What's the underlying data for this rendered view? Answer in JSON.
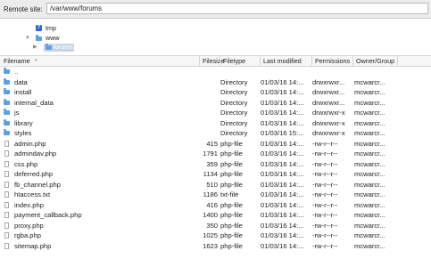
{
  "remote_site": {
    "label": "Remote site:",
    "path": "/var/www/forums"
  },
  "tree": [
    {
      "label": "tmp",
      "icon": "question-icon"
    },
    {
      "label": "www",
      "icon": "folder-icon"
    },
    {
      "label": "forums",
      "icon": "folder-icon",
      "selected": true
    }
  ],
  "columns": {
    "filename": "Filename",
    "filesize": "Filesize",
    "filetype": "Filetype",
    "modified": "Last modified",
    "permissions": "Permissions",
    "owner": "Owner/Group"
  },
  "rows": [
    {
      "name": "..",
      "kind": "folder",
      "size": "",
      "type": "",
      "modified": "",
      "perms": "",
      "owner": ""
    },
    {
      "name": "data",
      "kind": "folder",
      "size": "",
      "type": "Directory",
      "modified": "01/03/16 14:...",
      "perms": "drwxrwxr...",
      "owner": "mcwarcr..."
    },
    {
      "name": "install",
      "kind": "folder",
      "size": "",
      "type": "Directory",
      "modified": "01/03/16 14:...",
      "perms": "drwxrwxr...",
      "owner": "mcwarcr..."
    },
    {
      "name": "internal_data",
      "kind": "folder",
      "size": "",
      "type": "Directory",
      "modified": "01/03/16 14:...",
      "perms": "drwxrwxr...",
      "owner": "mcwarcr..."
    },
    {
      "name": "js",
      "kind": "folder",
      "size": "",
      "type": "Directory",
      "modified": "01/03/16 14:...",
      "perms": "drwxrwxr-x",
      "owner": "mcwarcr..."
    },
    {
      "name": "library",
      "kind": "folder",
      "size": "",
      "type": "Directory",
      "modified": "01/03/16 14:...",
      "perms": "drwxrwxr-x",
      "owner": "mcwarcr..."
    },
    {
      "name": "styles",
      "kind": "folder",
      "size": "",
      "type": "Directory",
      "modified": "01/03/16 15:...",
      "perms": "drwxrwxr-x",
      "owner": "mcwarcr..."
    },
    {
      "name": "admin.php",
      "kind": "file",
      "size": "415",
      "type": "php-file",
      "modified": "01/03/16 14:...",
      "perms": "-rw-r--r--",
      "owner": "mcwarcr..."
    },
    {
      "name": "admindav.php",
      "kind": "file",
      "size": "1791",
      "type": "php-file",
      "modified": "01/03/16 14:...",
      "perms": "-rw-r--r--",
      "owner": "mcwarcr..."
    },
    {
      "name": "css.php",
      "kind": "file",
      "size": "359",
      "type": "php-file",
      "modified": "01/03/16 14:...",
      "perms": "-rw-r--r--",
      "owner": "mcwarcr..."
    },
    {
      "name": "deferred.php",
      "kind": "file",
      "size": "1134",
      "type": "php-file",
      "modified": "01/03/16 14:...",
      "perms": "-rw-r--r--",
      "owner": "mcwarcr..."
    },
    {
      "name": "fb_channel.php",
      "kind": "file",
      "size": "510",
      "type": "php-file",
      "modified": "01/03/16 14:...",
      "perms": "-rw-r--r--",
      "owner": "mcwarcr..."
    },
    {
      "name": "htaccess.txt",
      "kind": "file",
      "size": "1186",
      "type": "txt-file",
      "modified": "01/03/16 14:...",
      "perms": "-rw-r--r--",
      "owner": "mcwarcr..."
    },
    {
      "name": "index.php",
      "kind": "file",
      "size": "416",
      "type": "php-file",
      "modified": "01/03/16 14:...",
      "perms": "-rw-r--r--",
      "owner": "mcwarcr..."
    },
    {
      "name": "payment_callback.php",
      "kind": "file",
      "size": "1400",
      "type": "php-file",
      "modified": "01/03/16 14:...",
      "perms": "-rw-r--r--",
      "owner": "mcwarcr..."
    },
    {
      "name": "proxy.php",
      "kind": "file",
      "size": "350",
      "type": "php-file",
      "modified": "01/03/16 14:...",
      "perms": "-rw-r--r--",
      "owner": "mcwarcr..."
    },
    {
      "name": "rgba.php",
      "kind": "file",
      "size": "1025",
      "type": "php-file",
      "modified": "01/03/16 14:...",
      "perms": "-rw-r--r--",
      "owner": "mcwarcr..."
    },
    {
      "name": "sitemap.php",
      "kind": "file",
      "size": "1623",
      "type": "php-file",
      "modified": "01/03/16 14:...",
      "perms": "-rw-r--r--",
      "owner": "mcwarcr..."
    }
  ],
  "colors": {
    "folder": "#5aa0e6",
    "selection": "#c8d4e6"
  }
}
